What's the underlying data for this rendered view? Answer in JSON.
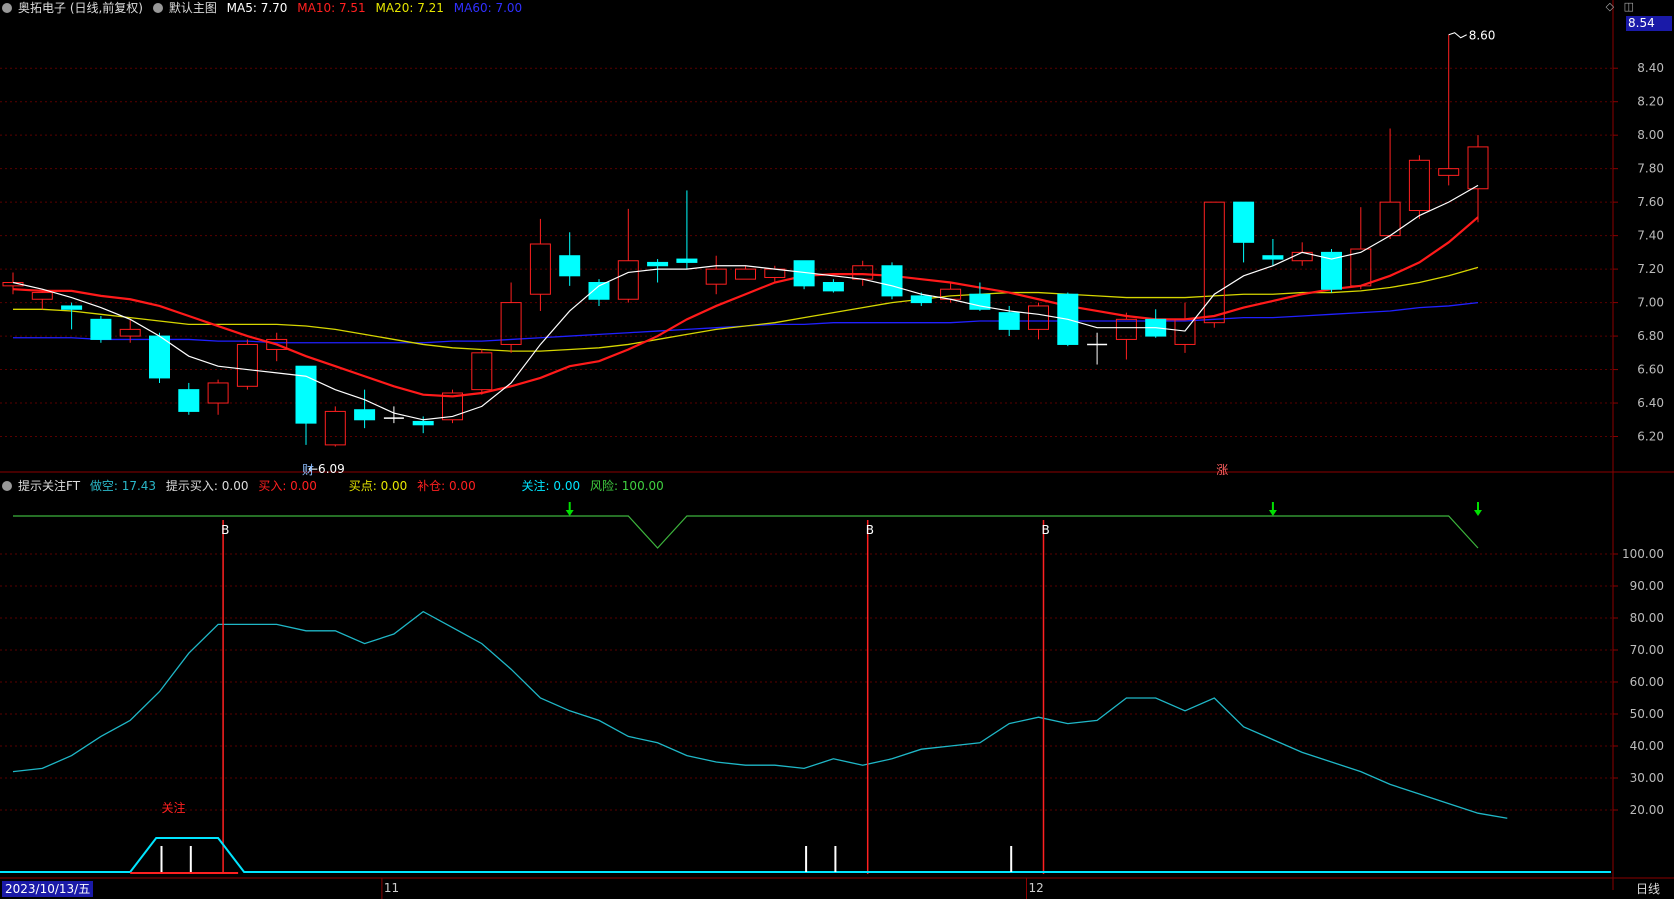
{
  "header1": {
    "title": "奥拓电子 (日线,前复权)",
    "main_chart": "默认主图",
    "ma5": "MA5: 7.70",
    "ma10": "MA10: 7.51",
    "ma20": "MA20: 7.21",
    "ma60": "MA60: 7.00",
    "colors": {
      "ma5": "#ffffff",
      "ma10": "#ff2020",
      "ma20": "#e6e600",
      "ma60": "#2020ff"
    }
  },
  "header2": {
    "title": "提示关注FT",
    "zuokong": "做空: 17.43",
    "tishi_mairu": "提示买入: 0.00",
    "mairu": "买入: 0.00",
    "maidian": "买点: 0.00",
    "bucang": "补仓: 0.00",
    "guanzhu": "关注: 0.00",
    "fengxian": "风险: 100.00"
  },
  "top_icons": [
    "diamond-icon",
    "panel-icon"
  ],
  "price_box": "8.54",
  "date_box": "2023/10/13/五",
  "period_label": "日线",
  "month_labels": [
    "11",
    "12"
  ],
  "annotations": {
    "low": "6.09",
    "high": "8.60",
    "cai": "财",
    "zhang": "涨",
    "guanzhu": "关注",
    "b": "B"
  },
  "chart_data": [
    {
      "type": "candlestick",
      "y_ticks": [
        "8.40",
        "8.20",
        "8.00",
        "7.80",
        "7.60",
        "7.40",
        "7.20",
        "7.00",
        "6.80",
        "6.60",
        "6.40",
        "6.20"
      ],
      "ylim": [
        6.0,
        8.7
      ],
      "candles": [
        [
          7.1,
          7.12,
          7.18,
          7.05
        ],
        [
          7.02,
          7.06,
          7.08,
          6.96
        ],
        [
          6.98,
          6.96,
          7.0,
          6.84
        ],
        [
          6.9,
          6.78,
          6.92,
          6.76
        ],
        [
          6.8,
          6.84,
          6.9,
          6.76
        ],
        [
          6.8,
          6.55,
          6.82,
          6.52
        ],
        [
          6.48,
          6.35,
          6.52,
          6.33
        ],
        [
          6.4,
          6.52,
          6.54,
          6.33
        ],
        [
          6.5,
          6.75,
          6.78,
          6.48
        ],
        [
          6.72,
          6.78,
          6.82,
          6.65
        ],
        [
          6.62,
          6.28,
          6.62,
          6.15
        ],
        [
          6.15,
          6.35,
          6.38,
          6.14
        ],
        [
          6.36,
          6.3,
          6.48,
          6.25
        ],
        [
          6.3,
          6.31,
          6.38,
          6.28
        ],
        [
          6.29,
          6.27,
          6.32,
          6.22
        ],
        [
          6.3,
          6.46,
          6.48,
          6.28
        ],
        [
          6.48,
          6.7,
          6.72,
          6.45
        ],
        [
          6.75,
          7.0,
          7.12,
          6.7
        ],
        [
          7.05,
          7.35,
          7.5,
          6.95
        ],
        [
          7.28,
          7.16,
          7.42,
          7.1
        ],
        [
          7.12,
          7.02,
          7.14,
          6.98
        ],
        [
          7.02,
          7.25,
          7.56,
          7.0
        ],
        [
          7.24,
          7.22,
          7.26,
          7.12
        ],
        [
          7.26,
          7.24,
          7.67,
          7.2
        ],
        [
          7.11,
          7.2,
          7.28,
          7.05
        ],
        [
          7.14,
          7.2,
          7.22,
          7.14
        ],
        [
          7.15,
          7.2,
          7.22,
          7.12
        ],
        [
          7.25,
          7.1,
          7.25,
          7.08
        ],
        [
          7.12,
          7.07,
          7.14,
          7.06
        ],
        [
          7.14,
          7.22,
          7.25,
          7.1
        ],
        [
          7.22,
          7.04,
          7.24,
          7.02
        ],
        [
          7.04,
          7.0,
          7.06,
          6.98
        ],
        [
          7.02,
          7.08,
          7.12,
          7.0
        ],
        [
          7.05,
          6.96,
          7.12,
          6.95
        ],
        [
          6.94,
          6.84,
          6.98,
          6.8
        ],
        [
          6.84,
          6.98,
          7.0,
          6.78
        ],
        [
          7.05,
          6.75,
          7.06,
          6.74
        ],
        [
          6.75,
          6.75,
          6.82,
          6.63
        ],
        [
          6.78,
          6.9,
          6.94,
          6.66
        ],
        [
          6.9,
          6.8,
          6.96,
          6.79
        ],
        [
          6.75,
          6.9,
          7.0,
          6.7
        ],
        [
          6.88,
          7.6,
          7.6,
          6.85
        ],
        [
          7.6,
          7.36,
          7.6,
          7.24
        ],
        [
          7.28,
          7.26,
          7.38,
          7.22
        ],
        [
          7.25,
          7.3,
          7.36,
          7.22
        ],
        [
          7.3,
          7.08,
          7.32,
          7.06
        ],
        [
          7.1,
          7.32,
          7.57,
          7.08
        ],
        [
          7.4,
          7.6,
          8.04,
          7.38
        ],
        [
          7.55,
          7.85,
          7.88,
          7.5
        ],
        [
          7.76,
          7.8,
          8.6,
          7.7
        ],
        [
          7.68,
          7.93,
          8.0,
          7.48
        ]
      ],
      "ma5": [
        7.12,
        7.08,
        7.03,
        6.97,
        6.9,
        6.8,
        6.68,
        6.62,
        6.6,
        6.58,
        6.56,
        6.48,
        6.42,
        6.34,
        6.3,
        6.32,
        6.38,
        6.52,
        6.75,
        6.95,
        7.1,
        7.18,
        7.2,
        7.2,
        7.22,
        7.22,
        7.2,
        7.18,
        7.16,
        7.14,
        7.1,
        7.05,
        7.02,
        6.98,
        6.95,
        6.93,
        6.9,
        6.85,
        6.85,
        6.85,
        6.83,
        7.05,
        7.16,
        7.22,
        7.3,
        7.26,
        7.3,
        7.4,
        7.52,
        7.6,
        7.7
      ],
      "ma10": [
        7.08,
        7.07,
        7.07,
        7.04,
        7.02,
        6.98,
        6.92,
        6.86,
        6.8,
        6.75,
        6.68,
        6.62,
        6.56,
        6.5,
        6.45,
        6.44,
        6.46,
        6.5,
        6.55,
        6.62,
        6.65,
        6.72,
        6.8,
        6.9,
        6.98,
        7.05,
        7.12,
        7.16,
        7.17,
        7.17,
        7.16,
        7.14,
        7.12,
        7.09,
        7.06,
        7.02,
        6.98,
        6.95,
        6.92,
        6.9,
        6.9,
        6.92,
        6.97,
        7.01,
        7.05,
        7.08,
        7.1,
        7.16,
        7.24,
        7.36,
        7.51
      ],
      "ma20": [
        6.96,
        6.96,
        6.95,
        6.93,
        6.91,
        6.89,
        6.87,
        6.87,
        6.87,
        6.87,
        6.86,
        6.84,
        6.81,
        6.78,
        6.75,
        6.73,
        6.72,
        6.71,
        6.71,
        6.72,
        6.73,
        6.75,
        6.78,
        6.81,
        6.84,
        6.86,
        6.88,
        6.91,
        6.94,
        6.97,
        7.0,
        7.02,
        7.04,
        7.05,
        7.06,
        7.06,
        7.05,
        7.04,
        7.03,
        7.03,
        7.03,
        7.04,
        7.05,
        7.05,
        7.06,
        7.06,
        7.07,
        7.09,
        7.12,
        7.16,
        7.21
      ],
      "ma60": [
        6.79,
        6.79,
        6.79,
        6.78,
        6.78,
        6.78,
        6.78,
        6.77,
        6.77,
        6.76,
        6.76,
        6.76,
        6.76,
        6.76,
        6.76,
        6.77,
        6.77,
        6.78,
        6.79,
        6.8,
        6.81,
        6.82,
        6.83,
        6.84,
        6.85,
        6.86,
        6.87,
        6.87,
        6.88,
        6.88,
        6.88,
        6.88,
        6.88,
        6.89,
        6.89,
        6.89,
        6.89,
        6.89,
        6.89,
        6.89,
        6.89,
        6.9,
        6.91,
        6.91,
        6.92,
        6.93,
        6.94,
        6.95,
        6.97,
        6.98,
        7.0
      ]
    },
    {
      "type": "line",
      "y_ticks": [
        "100.00",
        "90.00",
        "80.00",
        "70.00",
        "60.00",
        "50.00",
        "40.00",
        "30.00",
        "20.00"
      ],
      "ylim": [
        0,
        110
      ],
      "risk_signal": [
        100,
        100,
        100,
        100,
        100,
        100,
        100,
        100,
        100,
        100,
        100,
        100,
        100,
        100,
        100,
        100,
        100,
        100,
        100,
        100,
        100,
        100,
        90,
        100,
        100,
        100,
        100,
        100,
        100,
        100,
        100,
        100,
        100,
        100,
        100,
        100,
        100,
        100,
        100,
        100,
        100,
        100,
        100,
        100,
        100,
        100,
        100,
        100,
        100,
        100,
        90
      ],
      "zuokong": [
        32,
        33,
        37,
        43,
        48,
        57,
        69,
        78,
        78,
        78,
        76,
        76,
        72,
        75,
        82,
        77,
        72,
        64,
        55,
        51,
        48,
        43,
        41,
        37,
        35,
        34,
        34,
        33,
        36,
        34,
        36,
        39,
        40,
        41,
        47,
        49,
        47,
        48,
        55,
        55,
        51,
        55,
        46,
        42,
        38,
        35,
        32,
        28,
        25,
        22,
        19,
        17.43
      ],
      "b_signals": [
        7,
        29,
        35
      ],
      "down_arrows": [
        19,
        43,
        50
      ],
      "guanzhu_plateau": [
        4,
        7
      ],
      "white_ticks": [
        5,
        6,
        27,
        28,
        34
      ]
    }
  ]
}
